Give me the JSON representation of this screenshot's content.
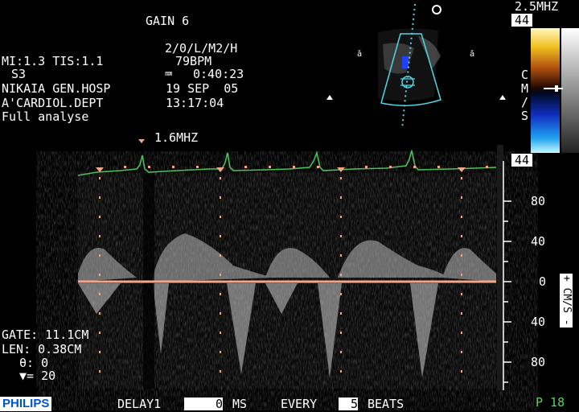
{
  "header": {
    "gain": "GAIN 6",
    "freq_top": "2.5MHZ",
    "mode_line": "2/0/L/M2/H",
    "mi_tis": "MI:1.3 TIS:1.1",
    "bpm": "79BPM",
    "probe": "S3",
    "timer": "0:40:23",
    "hospital": "NIKAIA GEN.HOSP",
    "date": "19 SEP  05",
    "dept": "A'CARDIOL.DEPT",
    "time": "13:17:04",
    "preset": "Full analyse",
    "doppler_freq": "1.6MHZ"
  },
  "colorbar": {
    "top_value": "44",
    "bottom_value": "44",
    "side_letters": [
      "C",
      "M",
      "/",
      "S"
    ]
  },
  "gate_info": {
    "gate": "GATE: 11.1CM",
    "len": "LEN: 0.38CM",
    "theta": "θ: 0",
    "sweep": "▼= 20"
  },
  "axis": {
    "unit_label": "+ CM/S -",
    "ticks": [
      "80",
      "40",
      "0",
      "40",
      "80"
    ]
  },
  "footer": {
    "brand": "PHILIPS",
    "delay_label": "DELAY1",
    "delay_value": "0",
    "delay_unit": "MS",
    "every_label": "EVERY",
    "every_value": "5",
    "beats_label": "BEATS",
    "page": "P 18"
  },
  "colors": {
    "baseline": "#f4a58a",
    "ecg": "#4cbf5a",
    "sector": "#4fd7e6"
  }
}
